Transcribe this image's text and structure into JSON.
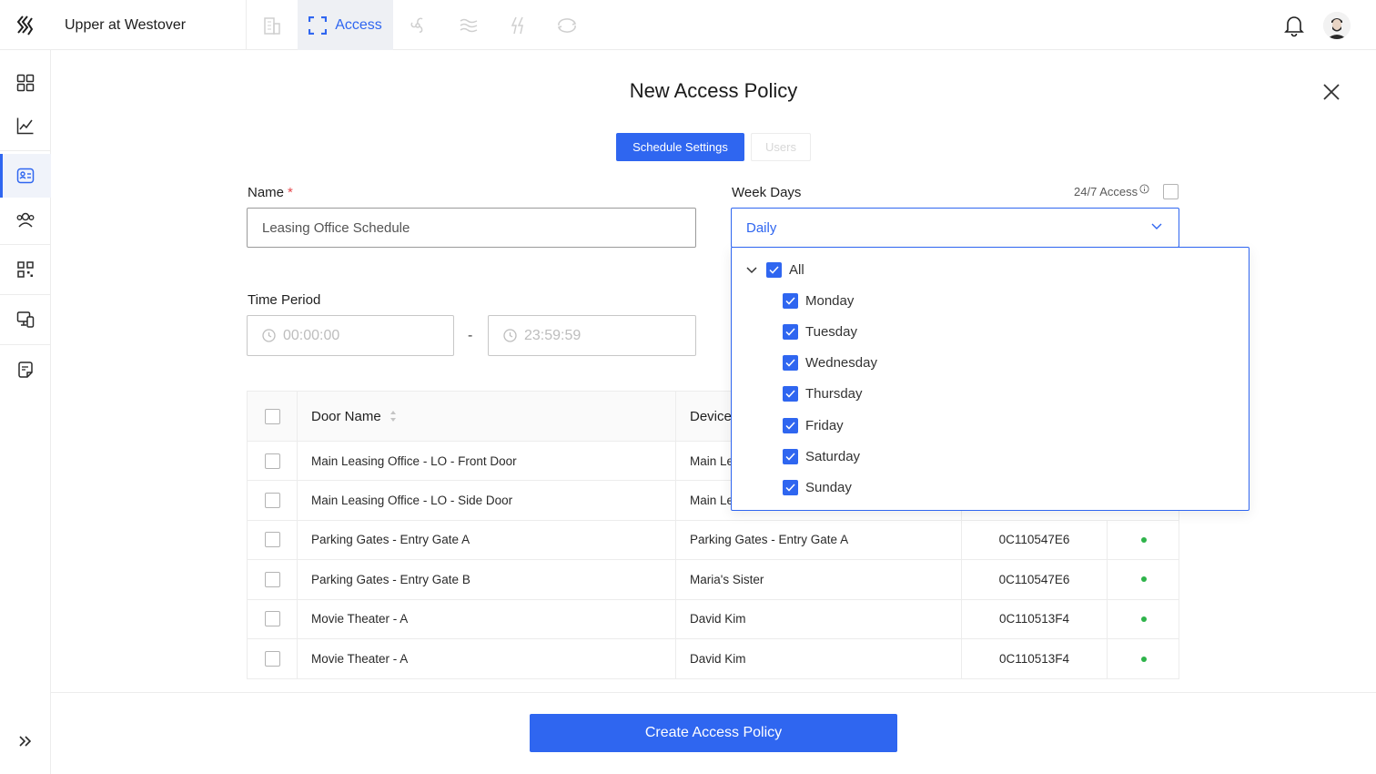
{
  "header": {
    "property_name": "Upper at Westover",
    "active_tab_label": "Access",
    "tabs": [
      "building-icon",
      "access-icon",
      "fan-icon",
      "water-icon",
      "energy-icon",
      "sync-icon"
    ]
  },
  "sidebar": {
    "items": [
      "dashboard-icon",
      "analytics-icon",
      "access-card-icon",
      "users-icon",
      "qr-icon",
      "devices-icon",
      "notes-icon",
      "expand-icon"
    ]
  },
  "modal": {
    "title": "New Access Policy",
    "tabs": {
      "schedule": "Schedule Settings",
      "users": "Users"
    },
    "name_label": "Name",
    "name_required_mark": "*",
    "name_value": "Leasing Office Schedule",
    "week_days_label": "Week Days",
    "access_247_label": "24/7 Access",
    "week_days_value": "Daily",
    "time_period_label": "Time Period",
    "time_start_placeholder": "00:00:00",
    "time_end_placeholder": "23:59:59",
    "time_separator": "-",
    "create_button": "Create Access Policy"
  },
  "weekday_dropdown": {
    "all_label": "All",
    "days": [
      "Monday",
      "Tuesday",
      "Wednesday",
      "Thursday",
      "Friday",
      "Saturday",
      "Sunday"
    ]
  },
  "table": {
    "columns": {
      "door_name": "Door Name",
      "device": "Device"
    },
    "rows": [
      {
        "door": "Main Leasing Office - LO - Front Door",
        "device": "Main Le",
        "serial": "",
        "status": ""
      },
      {
        "door": "Main Leasing Office - LO - Side Door",
        "device": "Main Le",
        "serial": "",
        "status": ""
      },
      {
        "door": "Parking Gates - Entry Gate A",
        "device": "Parking Gates - Entry Gate A",
        "serial": "0C110547E6",
        "status": "online"
      },
      {
        "door": "Parking Gates - Entry Gate B",
        "device": "Maria's Sister",
        "serial": "0C110547E6",
        "status": "online"
      },
      {
        "door": "Movie Theater - A",
        "device": "David Kim",
        "serial": "0C110513F4",
        "status": "online"
      },
      {
        "door": "Movie Theater - A",
        "device": "David Kim",
        "serial": "0C110513F4",
        "status": "online"
      }
    ]
  },
  "colors": {
    "accent": "#2f66f0",
    "online": "#2eb34a",
    "required": "#e5484d"
  }
}
